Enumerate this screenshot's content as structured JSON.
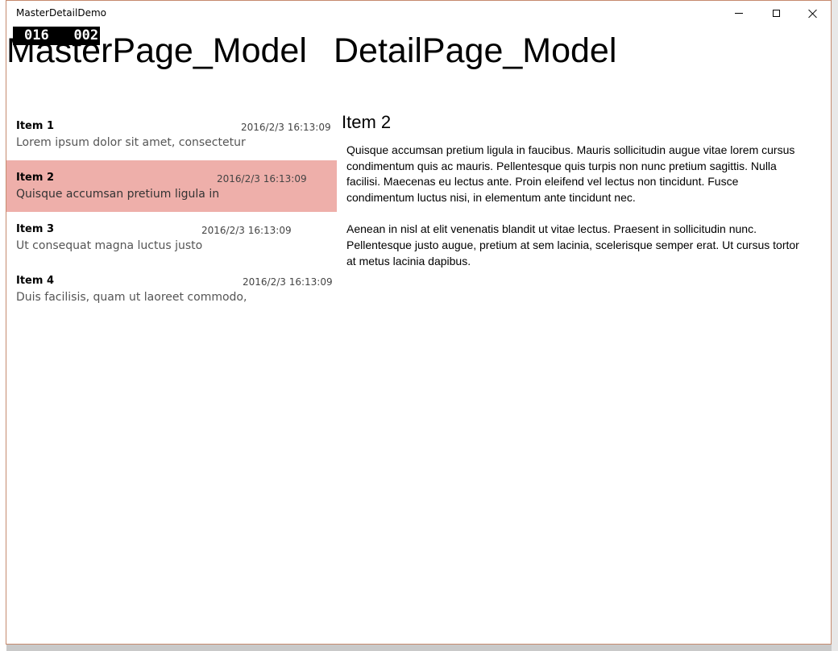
{
  "window": {
    "title": "MasterDetailDemo"
  },
  "fps_counter": {
    "left": "016",
    "right": "002"
  },
  "header": {
    "master_title": "MasterPage_Model",
    "detail_title": "DetailPage_Model"
  },
  "master": {
    "items": [
      {
        "title": "Item 1",
        "date": "2016/2/3 16:13:09",
        "snippet": "Lorem ipsum dolor sit amet, consectetur",
        "selected": false
      },
      {
        "title": "Item 2",
        "date": "2016/2/3 16:13:09",
        "snippet": "Quisque accumsan pretium ligula in",
        "selected": true
      },
      {
        "title": "Item 3",
        "date": "2016/2/3 16:13:09",
        "snippet": "Ut consequat magna luctus justo",
        "selected": false
      },
      {
        "title": "Item 4",
        "date": "2016/2/3 16:13:09",
        "snippet": "Duis facilisis, quam ut laoreet commodo,",
        "selected": false
      }
    ]
  },
  "detail": {
    "title": "Item 2",
    "paragraphs": [
      "Quisque accumsan pretium ligula in faucibus. Mauris sollicitudin augue vitae lorem cursus condimentum quis ac mauris. Pellentesque quis turpis non nunc pretium sagittis. Nulla facilisi. Maecenas eu lectus ante. Proin eleifend vel lectus non tincidunt. Fusce condimentum luctus nisi, in elementum ante tincidunt nec.",
      "Aenean in nisl at elit venenatis blandit ut vitae lectus. Praesent in sollicitudin nunc. Pellentesque justo augue, pretium at sem lacinia, scelerisque semper erat. Ut cursus tortor at metus lacinia dapibus."
    ]
  },
  "colors": {
    "selected_item": "#eeafaa",
    "window_border": "#c58a6e"
  }
}
